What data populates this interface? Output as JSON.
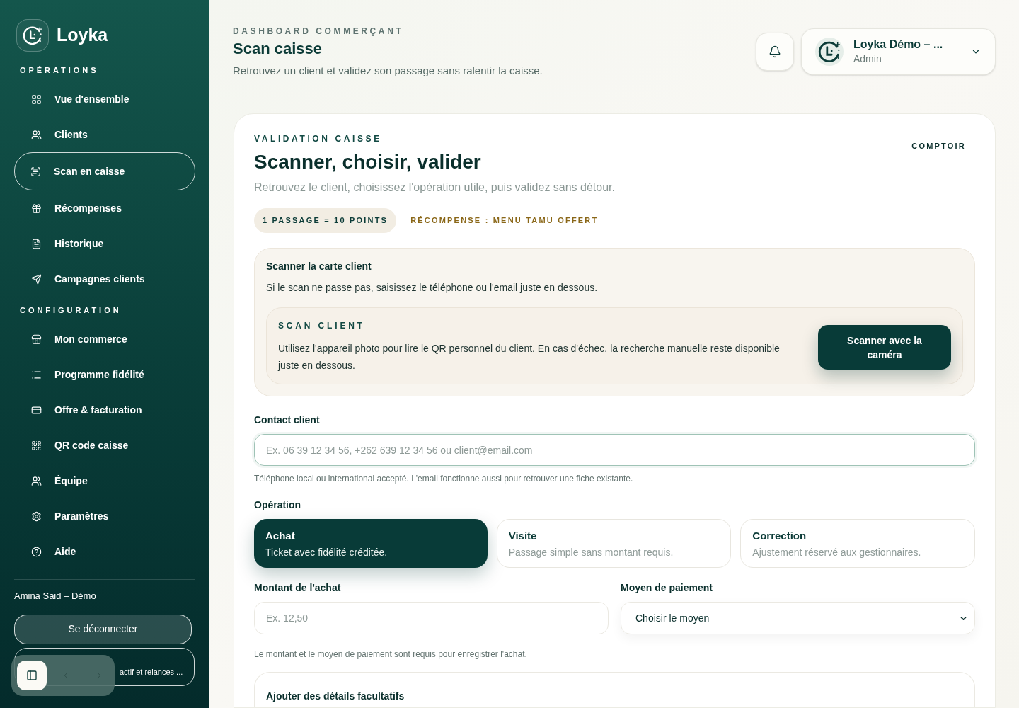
{
  "sidebar": {
    "brand": "Loyka",
    "sections": [
      {
        "heading": "OPÉRATIONS",
        "items": [
          {
            "label": "Vue d'ensemble",
            "selected": false
          },
          {
            "label": "Clients",
            "selected": false
          },
          {
            "label": "Scan en caisse",
            "selected": true
          },
          {
            "label": "Récompenses",
            "selected": false
          },
          {
            "label": "Historique",
            "selected": false
          },
          {
            "label": "Campagnes clients",
            "selected": false
          }
        ]
      },
      {
        "heading": "CONFIGURATION",
        "items": [
          {
            "label": "Mon commerce",
            "selected": false
          },
          {
            "label": "Programme fidélité",
            "selected": false
          },
          {
            "label": "Offre & facturation",
            "selected": false
          },
          {
            "label": "QR code caisse",
            "selected": false
          },
          {
            "label": "Équipe",
            "selected": false
          },
          {
            "label": "Paramètres",
            "selected": false
          },
          {
            "label": "Aide",
            "selected": false
          }
        ]
      }
    ],
    "user": "Amina Said – Démo",
    "logout_button": "Se déconnecter",
    "notice": "actif et relances ..."
  },
  "header": {
    "eyebrow": "DASHBOARD COMMERÇANT",
    "title": "Scan caisse",
    "subtitle": "Retrouvez un client et validez son passage sans ralentir la caisse.",
    "account": {
      "name": "Loyka Démo – ...",
      "role": "Admin"
    }
  },
  "card": {
    "eyebrow": "VALIDATION CAISSE",
    "tag": "COMPTOIR",
    "title": "Scanner, choisir, valider",
    "subtitle": "Retrouvez le client, choisissez l'opération utile, puis validez sans détour.",
    "badges": [
      {
        "text": "1 PASSAGE = 10 POINTS",
        "kind": "pill"
      },
      {
        "text": "RÉCOMPENSE : MENU TAMU OFFERT",
        "kind": "plain"
      }
    ],
    "scan_panel": {
      "title": "Scanner la carte client",
      "text": "Si le scan ne passe pas, saisissez le téléphone ou l'email juste en dessous.",
      "inner": {
        "eyebrow": "SCAN CLIENT",
        "text": "Utilisez l'appareil photo pour lire le QR personnel du client. En cas d'échec, la recherche manuelle reste disponible juste en dessous.",
        "button": "Scanner avec la caméra"
      }
    },
    "contact": {
      "label": "Contact client",
      "placeholder": "Ex. 06 39 12 34 56, +262 639 12 34 56 ou client@email.com",
      "hint": "Téléphone local ou international accepté. L'email fonctionne aussi pour retrouver une fiche existante."
    },
    "operation": {
      "label": "Opération",
      "options": [
        {
          "title": "Achat",
          "description": "Ticket avec fidélité créditée.",
          "selected": true
        },
        {
          "title": "Visite",
          "description": "Passage simple sans montant requis.",
          "selected": false
        },
        {
          "title": "Correction",
          "description": "Ajustement réservé aux gestionnaires.",
          "selected": false
        }
      ]
    },
    "amount": {
      "label": "Montant de l'achat",
      "placeholder": "Ex. 12,50"
    },
    "payment": {
      "label": "Moyen de paiement",
      "value": "Choisir le moyen"
    },
    "payment_hint": "Le montant et le moyen de paiement sont requis pour enregistrer l'achat.",
    "details": {
      "title": "Ajouter des détails facultatifs"
    }
  }
}
